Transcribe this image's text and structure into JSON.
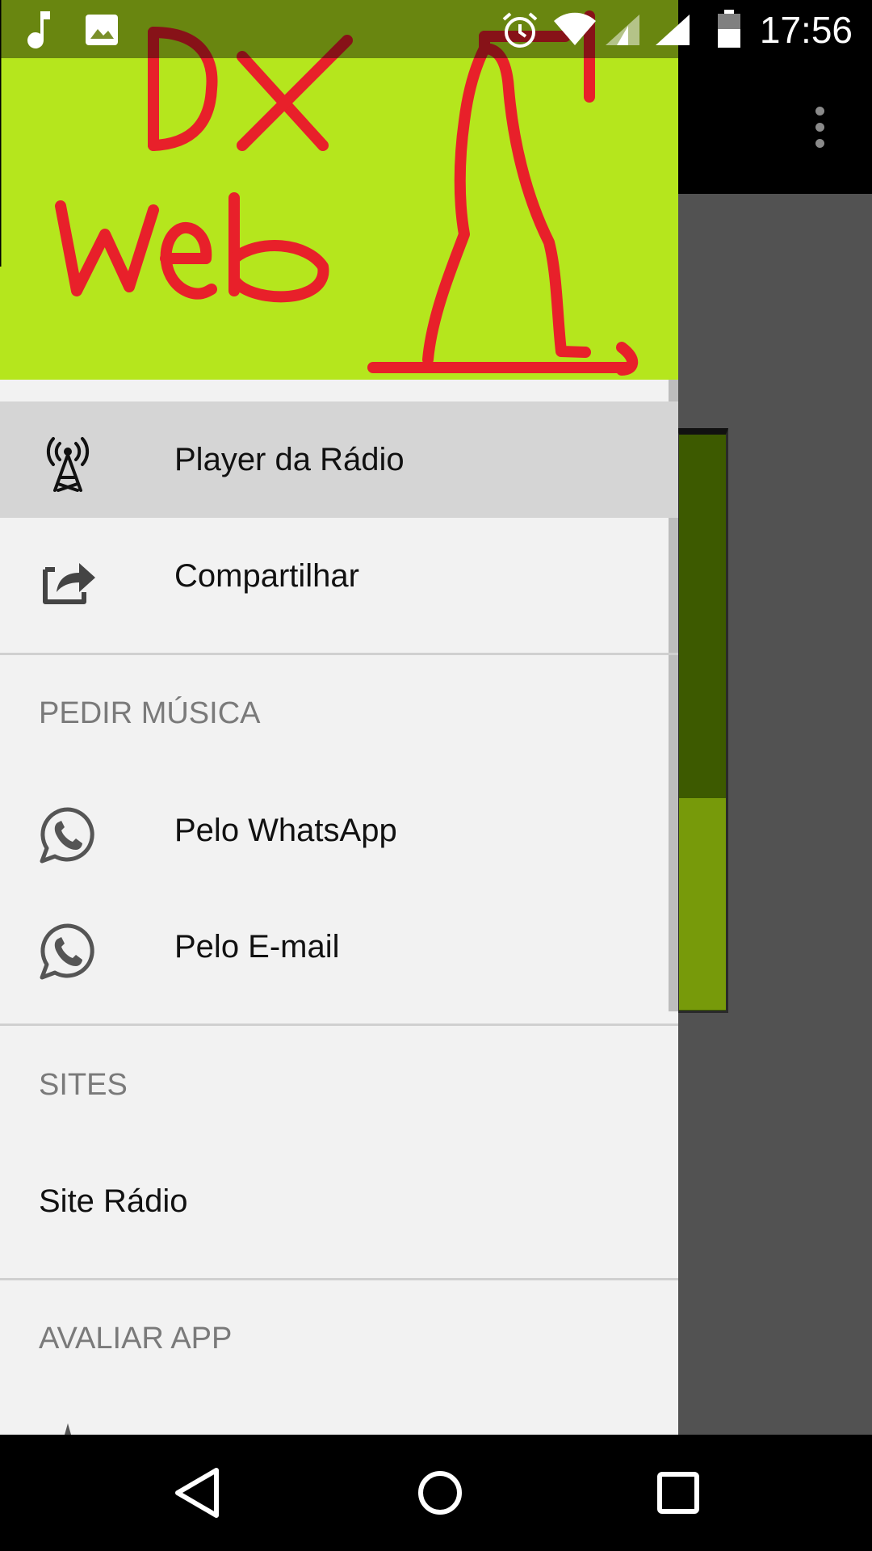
{
  "status_bar": {
    "time": "17:56",
    "left_icons": [
      "music-note-icon",
      "image-icon"
    ],
    "right_icons": [
      "alarm-icon",
      "wifi-icon",
      "signal-icon",
      "signal-icon",
      "battery-icon"
    ]
  },
  "drawer": {
    "header": {
      "logo_text": "Dx web",
      "background_color": "#b5e61d",
      "logo_color": "#e8202a"
    },
    "items": [
      {
        "label": "Player da Rádio",
        "icon": "radio-tower-icon",
        "selected": true
      },
      {
        "label": "Compartilhar",
        "icon": "share-icon",
        "selected": false
      }
    ],
    "sections": [
      {
        "header": "PEDIR MÚSICA",
        "items": [
          {
            "label": "Pelo WhatsApp",
            "icon": "whatsapp-icon"
          },
          {
            "label": "Pelo E-mail",
            "icon": "whatsapp-icon"
          }
        ]
      },
      {
        "header": "SITES",
        "items": [
          {
            "label": "Site Rádio",
            "icon": ""
          }
        ]
      },
      {
        "header": "AVALIAR APP",
        "items": []
      }
    ]
  },
  "nav_bar": {
    "buttons": [
      "back-icon",
      "home-icon",
      "recents-icon"
    ]
  },
  "colors": {
    "drawer_bg": "#f2f2f2",
    "selected_item_bg": "#d5d5d5",
    "section_header": "#7a7a7a",
    "background_card": "#3d5a00"
  }
}
